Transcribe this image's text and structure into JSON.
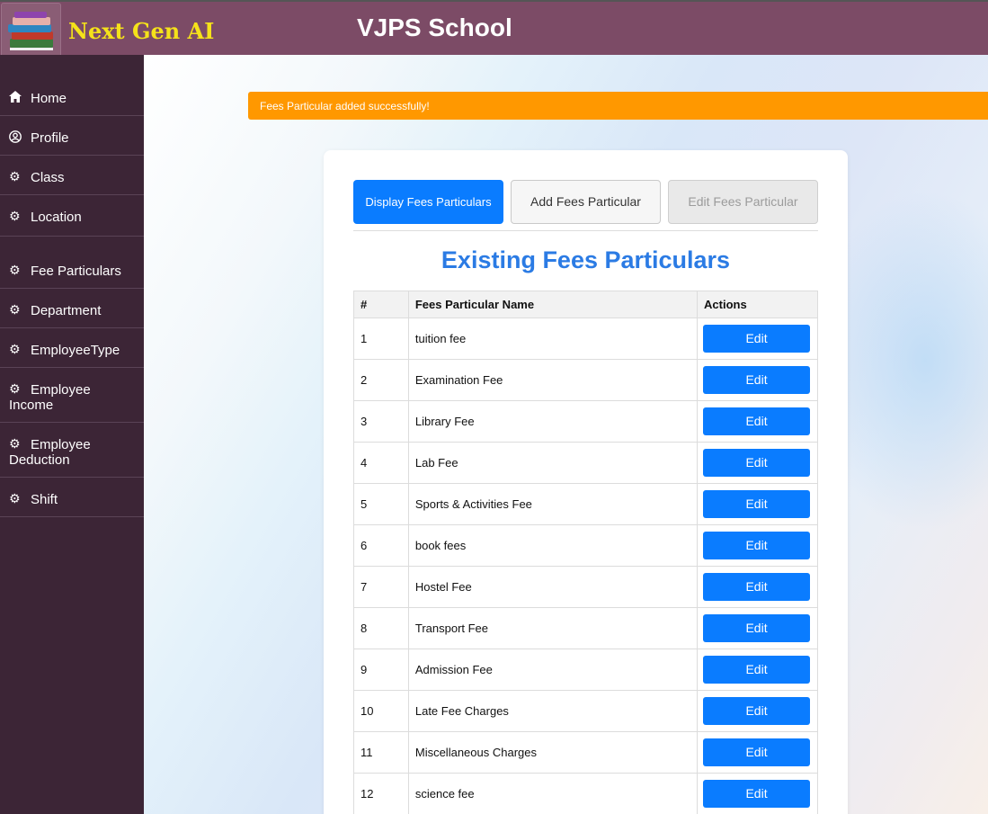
{
  "header": {
    "brand": "Next Gen AI",
    "title": "VJPS School",
    "bar_color": "#7c4b66",
    "brand_color": "#f5e21a"
  },
  "sidebar": {
    "items": [
      {
        "label": "Home",
        "icon": "home-icon"
      },
      {
        "label": "Profile",
        "icon": "user-circle-icon"
      },
      {
        "label": "Class",
        "icon": "gear-icon"
      },
      {
        "label": "Location",
        "icon": "gear-icon"
      },
      {
        "label": "Fee Particulars",
        "icon": "gear-icon"
      },
      {
        "label": "Department",
        "icon": "gear-icon"
      },
      {
        "label": "EmployeeType",
        "icon": "gear-icon"
      },
      {
        "label": "Employee Income",
        "icon": "gear-icon"
      },
      {
        "label": "Employee Deduction",
        "icon": "gear-icon"
      },
      {
        "label": "Shift",
        "icon": "gear-icon"
      }
    ]
  },
  "alert": {
    "message": "Fees Particular added successfully!",
    "color": "#ff9800"
  },
  "tabs": {
    "display": "Display Fees Particulars",
    "add": "Add Fees Particular",
    "edit": "Edit Fees Particular"
  },
  "section_title": "Existing Fees Particulars",
  "table": {
    "headers": [
      "#",
      "Fees Particular Name",
      "Actions"
    ],
    "rows": [
      {
        "num": "1",
        "name": "tuition fee",
        "action": "Edit"
      },
      {
        "num": "2",
        "name": "Examination Fee",
        "action": "Edit"
      },
      {
        "num": "3",
        "name": "Library Fee",
        "action": "Edit"
      },
      {
        "num": "4",
        "name": "Lab Fee",
        "action": "Edit"
      },
      {
        "num": "5",
        "name": "Sports & Activities Fee",
        "action": "Edit"
      },
      {
        "num": "6",
        "name": "book fees",
        "action": "Edit"
      },
      {
        "num": "7",
        "name": "Hostel Fee",
        "action": "Edit"
      },
      {
        "num": "8",
        "name": "Transport Fee",
        "action": "Edit"
      },
      {
        "num": "9",
        "name": "Admission Fee",
        "action": "Edit"
      },
      {
        "num": "10",
        "name": "Late Fee Charges",
        "action": "Edit"
      },
      {
        "num": "11",
        "name": "Miscellaneous Charges",
        "action": "Edit"
      },
      {
        "num": "12",
        "name": "science fee",
        "action": "Edit"
      }
    ]
  }
}
